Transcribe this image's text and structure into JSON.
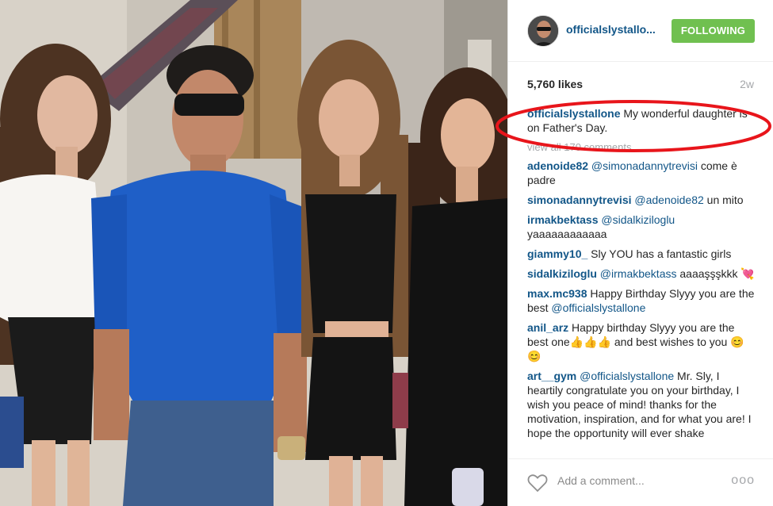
{
  "post": {
    "username": "officialslystallo...",
    "follow_label": "FOLLOWING",
    "likes": "5,760 likes",
    "age": "2w"
  },
  "caption": {
    "user": "officialslystallone",
    "text": " My wonderful daughter is on Father's Day."
  },
  "view_all": "view all 170 comments",
  "comments": [
    {
      "user": "adenoide82",
      "mention": "@simonadannytrevisi",
      "text": " come è padre"
    },
    {
      "user": "simonadannytrevisi",
      "mention": "@adenoide82",
      "text": " un mito"
    },
    {
      "user": "irmakbektass",
      "mention": "@sidalkiziloglu",
      "text": " yaaaaaaaaaaaa"
    },
    {
      "user": "giammy10_",
      "mention": "",
      "text": " Sly YOU has a fantastic girls"
    },
    {
      "user": "sidalkiziloglu",
      "mention": "@irmakbektass",
      "text": " aaaaşşşkkk 💘"
    },
    {
      "user": "max.mc938",
      "mention": "",
      "text": " Happy Birthday Slyyy you are the best ",
      "mention2": "@officialslystallone"
    },
    {
      "user": "anil_arz",
      "mention": "",
      "text": " Happy birthday Slyyy you are the best one👍👍👍 and best wishes to you 😊😊"
    },
    {
      "user": "art__gym",
      "mention": "@officialslystallone",
      "text": " Mr. Sly, I heartily congratulate you on your birthday, I wish you peace of mind! thanks for the motivation, inspiration, and for what you are! I hope the opportunity will ever shake"
    }
  ],
  "footer": {
    "placeholder": "Add a comment...",
    "more": "ooo"
  },
  "colors": {
    "username": "#125688",
    "follow_bg": "#70c050",
    "annotation": "#e8151b",
    "muted": "#a5a7aa"
  }
}
